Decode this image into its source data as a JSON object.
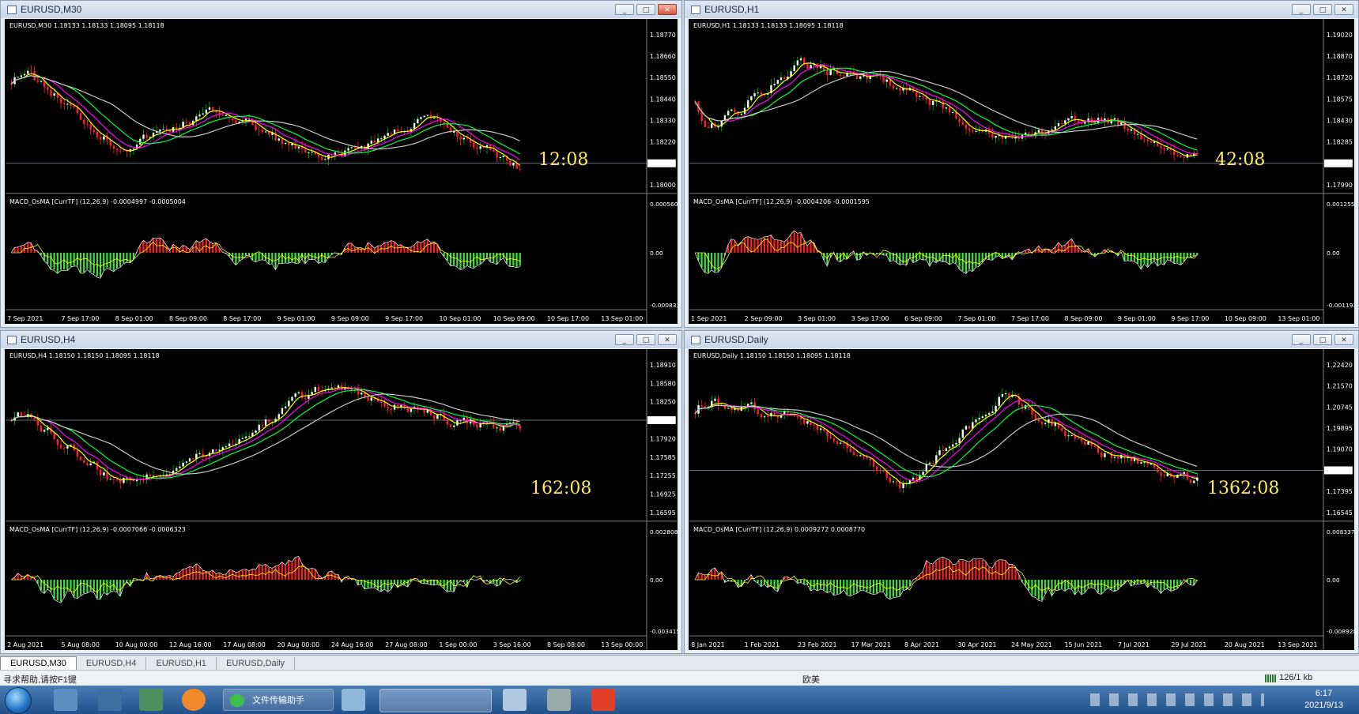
{
  "windows": [
    {
      "title": "EURUSD,M30",
      "header": "EURUSD,M30  1.18133 1.18133 1.18095 1.18118",
      "timer": "12:08",
      "price_labels": [
        "1.18770",
        "1.18660",
        "1.18550",
        "1.18440",
        "1.18330",
        "1.18220",
        "1.18118",
        "1.18000"
      ],
      "macd_header": "MACD_OsMA [CurrTF] (12,26,9) -0.0004997 -0.0005004",
      "macd_labels": [
        "0.000560",
        "0.00",
        "-0.000833"
      ],
      "time_labels": [
        "7 Sep 2021",
        "7 Sep 17:00",
        "8 Sep 01:00",
        "8 Sep 09:00",
        "8 Sep 17:00",
        "9 Sep 01:00",
        "9 Sep 09:00",
        "9 Sep 17:00",
        "10 Sep 01:00",
        "10 Sep 09:00",
        "10 Sep 17:00",
        "13 Sep 01:00"
      ],
      "close_red": true
    },
    {
      "title": "EURUSD,H1",
      "header": "EURUSD,H1  1.18133 1.18133 1.18095 1.18118",
      "timer": "42:08",
      "price_labels": [
        "1.19020",
        "1.18870",
        "1.18720",
        "1.18575",
        "1.18430",
        "1.18285",
        "1.18118",
        "1.17990"
      ],
      "macd_header": "MACD_OsMA [CurrTF] (12,26,9) -0.0004206 -0.0001595",
      "macd_labels": [
        "0.0012553",
        "0.00",
        "-0.001193"
      ],
      "time_labels": [
        "1 Sep 2021",
        "2 Sep 09:00",
        "3 Sep 01:00",
        "3 Sep 17:00",
        "6 Sep 09:00",
        "7 Sep 01:00",
        "7 Sep 17:00",
        "8 Sep 09:00",
        "9 Sep 01:00",
        "9 Sep 17:00",
        "10 Sep 09:00",
        "13 Sep 01:00"
      ],
      "close_red": false
    },
    {
      "title": "EURUSD,H4",
      "header": "EURUSD,H4  1.18150 1.18150 1.18095 1.18118",
      "timer": "162:08",
      "price_labels": [
        "1.18910",
        "1.18580",
        "1.18250",
        "1.18118",
        "1.17920",
        "1.17585",
        "1.17255",
        "1.16925",
        "1.16595"
      ],
      "macd_header": "MACD_OsMA [CurrTF] (12,26,9) -0.0007066 -0.0006323",
      "macd_labels": [
        "0.0028083",
        "0.00",
        "-0.003415"
      ],
      "time_labels": [
        "2 Aug 2021",
        "5 Aug 08:00",
        "10 Aug 00:00",
        "12 Aug 16:00",
        "17 Aug 08:00",
        "20 Aug 00:00",
        "24 Aug 16:00",
        "27 Aug 08:00",
        "1 Sep 00:00",
        "3 Sep 16:00",
        "8 Sep 08:00",
        "13 Sep 00:00"
      ],
      "close_red": false
    },
    {
      "title": "EURUSD,Daily",
      "header": "EURUSD,Daily  1.18150 1.18150 1.18095 1.18118",
      "timer": "1362:08",
      "price_labels": [
        "1.22420",
        "1.21570",
        "1.20745",
        "1.19895",
        "1.19070",
        "1.18118",
        "1.17395",
        "1.16545"
      ],
      "macd_header": "MACD_OsMA [CurrTF] (12,26,9) 0.0009272 0.0008770",
      "macd_labels": [
        "0.0083375",
        "0.00",
        "-0.008928"
      ],
      "time_labels": [
        "8 Jan 2021",
        "1 Feb 2021",
        "23 Feb 2021",
        "17 Mar 2021",
        "8 Apr 2021",
        "30 Apr 2021",
        "24 May 2021",
        "15 Jun 2021",
        "7 Jul 2021",
        "29 Jul 2021",
        "20 Aug 2021",
        "13 Sep 2021"
      ],
      "close_red": false
    }
  ],
  "tabs": [
    "EURUSD,M30",
    "EURUSD,H4",
    "EURUSD,H1",
    "EURUSD,Daily"
  ],
  "status": {
    "help": "寻求帮助,请按F1键",
    "profile": "欧美",
    "traffic": "126/1 kb"
  },
  "taskbar": {
    "wechat_label": "文件传输助手",
    "time": "6:17",
    "date": "2021/9/13"
  },
  "colors": {
    "bull": "#00c000",
    "bear": "#ff2020",
    "ma_fast": "#ffff00",
    "ma_mid": "#ff00ff",
    "ma_slow": "#00ff40",
    "ma_long": "#c8c8c8",
    "timer": "#ffe96a"
  }
}
